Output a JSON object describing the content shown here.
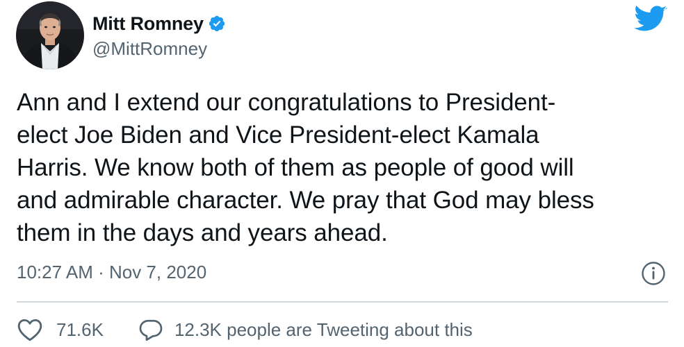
{
  "author": {
    "display_name": "Mitt Romney",
    "handle": "@MittRomney",
    "verified": true
  },
  "tweet": {
    "text": "Ann and I extend our congratulations to President-\nelect Joe Biden and Vice President-elect Kamala\nHarris. We know both of them as people of good will\nand admirable character. We pray that God may bless\nthem in the days and years ahead.",
    "timestamp": "10:27 AM · Nov 7, 2020"
  },
  "engagement": {
    "likes": "71.6K",
    "conversation": "12.3K people are Tweeting about this"
  },
  "icons": {
    "verified": "verified-badge-icon",
    "brand": "twitter-bird-icon",
    "info": "info-icon",
    "like": "heart-icon",
    "reply": "speech-bubble-icon"
  },
  "colors": {
    "brand_blue": "#1d9bf0",
    "text_primary": "#0f1419",
    "text_secondary": "#536471",
    "divider": "#cfd9de"
  }
}
